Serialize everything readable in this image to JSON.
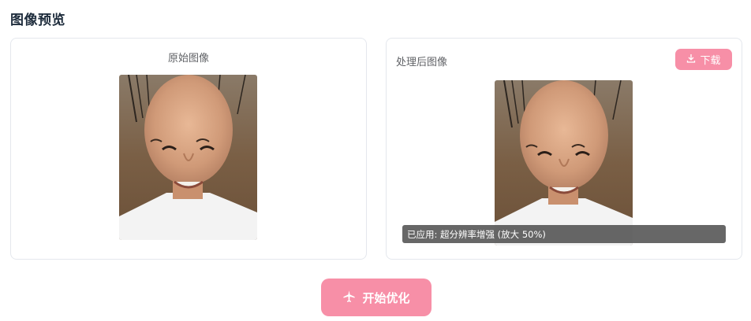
{
  "page": {
    "title": "图像预览"
  },
  "original": {
    "label": "原始图像"
  },
  "processed": {
    "label": "处理后图像",
    "download_label": "下载",
    "applied_text": "已应用: 超分辨率增强 (放大 50%)"
  },
  "actions": {
    "start_label": "开始优化"
  },
  "colors": {
    "accent": "#f78fa7",
    "border": "#e4e7ed",
    "overlay": "#3c3c3c"
  },
  "icons": {
    "download": "download-icon",
    "start": "airplane-icon"
  }
}
